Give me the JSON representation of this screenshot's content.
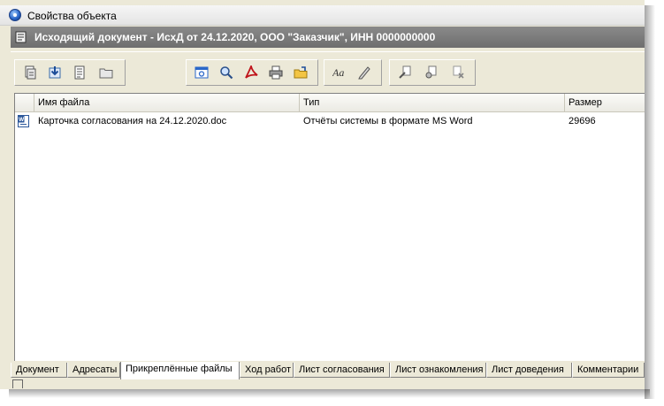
{
  "window": {
    "title": "Свойства объекта"
  },
  "header": {
    "text": "Исходящий документ - ИсхД от 24.12.2020, ООО \"Заказчик\", ИНН 0000000000"
  },
  "toolbar": {
    "groups": [
      {
        "buttons": [
          "add-file-icon",
          "import-icon",
          "properties-icon",
          "open-folder-icon"
        ]
      },
      {
        "buttons": [
          "preview-icon",
          "search-icon",
          "pdf-icon",
          "print-icon",
          "export-icon"
        ]
      },
      {
        "buttons": [
          "rename-icon",
          "edit-icon"
        ]
      },
      {
        "buttons": [
          "sign-icon",
          "verify-sign-icon",
          "remove-sign-icon"
        ]
      }
    ]
  },
  "files_table": {
    "columns": [
      "Имя файла",
      "Тип",
      "Размер"
    ],
    "rows": [
      {
        "icon": "word-document-icon",
        "name": "Карточка согласования на 24.12.2020.doc",
        "type": "Отчёты системы в формате MS Word",
        "size": "29696"
      }
    ]
  },
  "tabs": [
    {
      "label": "Документ",
      "active": false
    },
    {
      "label": "Адресаты",
      "active": false
    },
    {
      "label": "Прикреплённые файлы",
      "active": true
    },
    {
      "label": "Ход работ",
      "active": false
    },
    {
      "label": "Лист согласования",
      "active": false
    },
    {
      "label": "Лист ознакомления",
      "active": false
    },
    {
      "label": "Лист доведения",
      "active": false
    },
    {
      "label": "Комментарии",
      "active": false
    }
  ],
  "colors": {
    "header_bg": "#7a7a7a",
    "window_bg": "#ece9d8",
    "accent_blue": "#2a67c9"
  }
}
